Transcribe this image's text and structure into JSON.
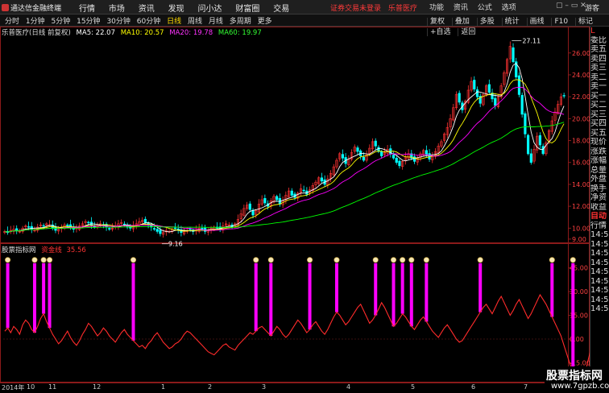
{
  "app": {
    "title": "通达信金融终端"
  },
  "menu": [
    "行情",
    "市场",
    "资讯",
    "发现",
    "问小达",
    "财富圈",
    "交易"
  ],
  "notice": [
    "证券交易未登录",
    "乐普医疗"
  ],
  "top_right": [
    "功能",
    "资讯",
    "公式",
    "选项"
  ],
  "guest": "游客",
  "period_tabs": [
    "分时",
    "1分钟",
    "5分钟",
    "15分钟",
    "30分钟",
    "60分钟",
    "日线",
    "周线",
    "月线",
    "多周期",
    "更多"
  ],
  "active_tab": "日线",
  "tools": [
    "复权",
    "叠加",
    "多股",
    "统计",
    "画线",
    "F10",
    "标记",
    "+自选",
    "返回"
  ],
  "ma_info": {
    "name": "乐普医疗(日线 前复权)",
    "ma5": "MA5: 22.07",
    "ma10": "MA10: 20.57",
    "ma20": "MA20: 19.78",
    "ma60": "MA60: 19.97"
  },
  "indicator": {
    "source": "股票指标网",
    "name": "资金线",
    "value": "35.56"
  },
  "price_axis": [
    "26.00",
    "24.00",
    "22.00",
    "20.00",
    "18.00",
    "16.00",
    "14.00",
    "12.00",
    "10.00",
    "9.00"
  ],
  "ind_axis": [
    "45.00",
    "30.00",
    "15.00",
    "0.00",
    "-15.00"
  ],
  "annotations": {
    "high": "27.11",
    "low": "9.16"
  },
  "side_panel": {
    "header": "L",
    "rows": [
      "委比",
      "卖五",
      "卖四",
      "卖三",
      "卖二",
      "卖一",
      "买一",
      "买二",
      "买三",
      "买四",
      "买五",
      "现价",
      "涨跌",
      "涨幅",
      "总量",
      "外盘",
      "换手",
      "净资",
      "收益",
      "自动",
      "行情",
      "14:50",
      "14:50",
      "14:50",
      "14:50",
      "14:50",
      "14:50",
      "14:50",
      "14:50",
      "14:50"
    ]
  },
  "date_axis": [
    "2014年",
    "10",
    "11",
    "12",
    "1",
    "2",
    "3",
    "4",
    "5",
    "6",
    "7"
  ],
  "watermark": {
    "line1": "股票指标网",
    "line2": "www.7gpzb.com"
  },
  "colors": {
    "ma5": "#ffffff",
    "ma10": "#ffff00",
    "ma20": "#ff00ff",
    "ma60": "#00ff00",
    "indicator": "#ff2b2b",
    "signal_bar": "#ff00ff",
    "candle_up": "#ff3232",
    "candle_down": "#00ffff"
  },
  "chart_data": [
    {
      "type": "candlestick",
      "title": "乐普医疗(日线 前复权)",
      "y_ticks": [
        9,
        10,
        12,
        14,
        16,
        18,
        20,
        22,
        24,
        26
      ],
      "ylim": [
        8.7,
        27.6
      ],
      "high_label": 27.11,
      "low_label": 9.16,
      "close": [
        9.7,
        9.6,
        9.8,
        9.9,
        9.8,
        9.7,
        10,
        10.2,
        10.1,
        9.9,
        9.8,
        10.1,
        10.3,
        10.2,
        10.4,
        10.3,
        10,
        9.8,
        9.9,
        10.1,
        10.3,
        10.2,
        10.1,
        9.9,
        10,
        10.2,
        10.4,
        10.6,
        10.5,
        10.3,
        10.1,
        10.2,
        10.4,
        10.3,
        10.1,
        9.9,
        10,
        10.2,
        10.4,
        10.5,
        10.3,
        10.1,
        10,
        10.2,
        10.4,
        10.6,
        10.7,
        10.5,
        10.3,
        10.1,
        9.9,
        9.7,
        9.5,
        9.6,
        9.8,
        9.7,
        9.9,
        10,
        9.8,
        9.6,
        9.7,
        9.8,
        9.9,
        9.7,
        9.8,
        10,
        9.9,
        9.7,
        9.8,
        10,
        10.1,
        10,
        9.9,
        10.2,
        10.4,
        10.3,
        10.1,
        10.4,
        10.8,
        11.3,
        11.8,
        12.1,
        11.7,
        11.2,
        11.6,
        12.2,
        12.6,
        12.3,
        12.0,
        12.5,
        12.9,
        12.6,
        12.2,
        12.5,
        13.0,
        13.4,
        13.0,
        12.8,
        13.2,
        13.6,
        13.4,
        13.1,
        13.5,
        13.9,
        14.2,
        14.6,
        14.3,
        14.0,
        14.5,
        15.0,
        15.6,
        16.2,
        16.8,
        16.4,
        15.9,
        16.3,
        16.9,
        17.4,
        17.0,
        16.6,
        16.2,
        16.7,
        17.3,
        17.9,
        17.5,
        17.0,
        16.6,
        16.9,
        17.2,
        16.8,
        16.4,
        16.0,
        15.7,
        16.1,
        16.5,
        16.8,
        16.4,
        16.1,
        16.4,
        16.8,
        17.1,
        16.7,
        16.3,
        16.6,
        17.0,
        17.5,
        17.9,
        18.6,
        19.2,
        20.0,
        21.0,
        22.2,
        21.5,
        20.8,
        21.6,
        22.6,
        23.4,
        22.7,
        22.0,
        21.4,
        22.2,
        23.0,
        22.4,
        21.8,
        21.2,
        22.0,
        23.0,
        24.2,
        25.4,
        26.6,
        25.2,
        23.8,
        22.2,
        20.4,
        18.6,
        16.8,
        16.0,
        17.2,
        18.4,
        17.6,
        16.8,
        17.8,
        18.9,
        19.8,
        20.6,
        21.3,
        22.0,
        22.1
      ]
    },
    {
      "type": "bar+line",
      "title": "资金线",
      "y_ticks": [
        -15,
        0,
        15,
        30,
        45
      ],
      "ylim": [
        -27,
        55
      ],
      "signal_bars": [
        1,
        10,
        13,
        15,
        43,
        84,
        89,
        102,
        111,
        124,
        130,
        133,
        136,
        141,
        159,
        183,
        190,
        198,
        204,
        213,
        220
      ],
      "bar_level": 48,
      "values": [
        5,
        7,
        4,
        8,
        6,
        3,
        9,
        12,
        10,
        6,
        4,
        8,
        13,
        16,
        11,
        7,
        3,
        0,
        -3,
        -1,
        2,
        5,
        1,
        -2,
        -4,
        -1,
        3,
        6,
        10,
        8,
        5,
        2,
        4,
        7,
        5,
        2,
        0,
        -2,
        1,
        4,
        6,
        3,
        1,
        -1,
        -3,
        -5,
        -4,
        -6,
        -3,
        -1,
        2,
        4,
        1,
        -2,
        -4,
        -6,
        -5,
        -3,
        -2,
        0,
        3,
        5,
        4,
        2,
        0,
        -2,
        -4,
        -6,
        -8,
        -9,
        -10,
        -8,
        -6,
        -4,
        -3,
        -5,
        -6,
        -7,
        -4,
        -2,
        0,
        2,
        4,
        3,
        5,
        7,
        8,
        6,
        4,
        2,
        5,
        8,
        6,
        3,
        1,
        3,
        6,
        9,
        12,
        10,
        7,
        4,
        6,
        9,
        11,
        8,
        5,
        3,
        6,
        10,
        14,
        17,
        15,
        12,
        9,
        11,
        14,
        17,
        20,
        22,
        18,
        14,
        10,
        12,
        15,
        19,
        23,
        20,
        16,
        12,
        8,
        10,
        13,
        16,
        14,
        11,
        8,
        6,
        9,
        12,
        14,
        11,
        8,
        5,
        3,
        1,
        4,
        7,
        9,
        6,
        3,
        0,
        -2,
        -1,
        2,
        5,
        8,
        11,
        14,
        17,
        20,
        22,
        19,
        16,
        20,
        24,
        27,
        23,
        19,
        15,
        18,
        22,
        25,
        21,
        17,
        13,
        16,
        20,
        24,
        28,
        25,
        22,
        18,
        14,
        10,
        6,
        2,
        -4,
        -10,
        -16,
        -21,
        -24,
        -20,
        -25,
        -22,
        -14,
        -6,
        2,
        12,
        20,
        27,
        24,
        28,
        33,
        35.56
      ],
      "x_ticks": [
        "2014年",
        "10",
        "11",
        "12",
        "1",
        "2",
        "3",
        "4",
        "5",
        "6",
        "7"
      ]
    }
  ]
}
